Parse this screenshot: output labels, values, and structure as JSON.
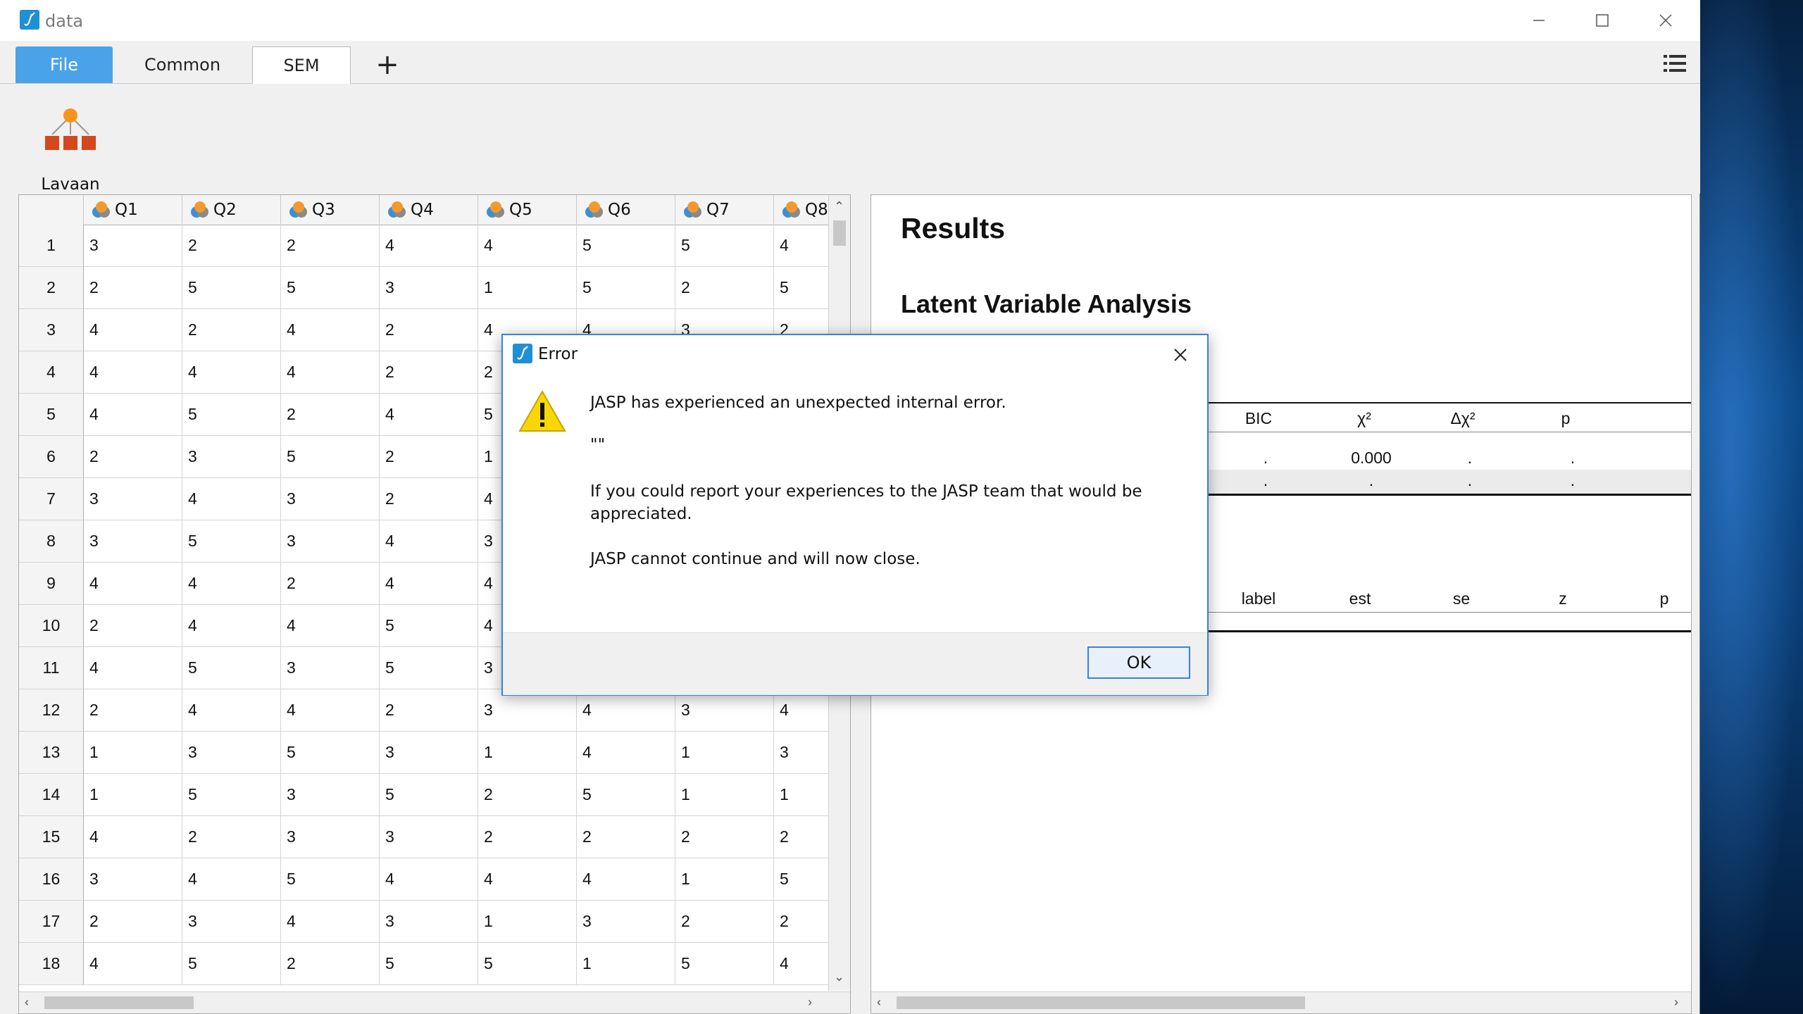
{
  "window": {
    "title": "data"
  },
  "tabs": [
    {
      "label": "File"
    },
    {
      "label": "Common"
    },
    {
      "label": "SEM"
    },
    {
      "label": "+"
    }
  ],
  "ribbon": {
    "lavaan_label": "Lavaan"
  },
  "grid": {
    "columns": [
      "Q1",
      "Q2",
      "Q3",
      "Q4",
      "Q5",
      "Q6",
      "Q7",
      "Q8"
    ],
    "rows": [
      {
        "n": "1",
        "v": [
          "3",
          "2",
          "2",
          "4",
          "4",
          "5",
          "5",
          "4"
        ]
      },
      {
        "n": "2",
        "v": [
          "2",
          "5",
          "5",
          "3",
          "1",
          "5",
          "2",
          "5"
        ]
      },
      {
        "n": "3",
        "v": [
          "4",
          "2",
          "4",
          "2",
          "4",
          "4",
          "3",
          "2"
        ]
      },
      {
        "n": "4",
        "v": [
          "4",
          "4",
          "4",
          "2",
          "2",
          "",
          "",
          ""
        ]
      },
      {
        "n": "5",
        "v": [
          "4",
          "5",
          "2",
          "4",
          "5",
          "",
          "",
          ""
        ]
      },
      {
        "n": "6",
        "v": [
          "2",
          "3",
          "5",
          "2",
          "1",
          "",
          "",
          ""
        ]
      },
      {
        "n": "7",
        "v": [
          "3",
          "4",
          "3",
          "2",
          "4",
          "",
          "",
          ""
        ]
      },
      {
        "n": "8",
        "v": [
          "3",
          "5",
          "3",
          "4",
          "3",
          "",
          "",
          ""
        ]
      },
      {
        "n": "9",
        "v": [
          "4",
          "4",
          "2",
          "4",
          "4",
          "",
          "",
          ""
        ]
      },
      {
        "n": "10",
        "v": [
          "2",
          "4",
          "4",
          "5",
          "4",
          "",
          "",
          ""
        ]
      },
      {
        "n": "11",
        "v": [
          "4",
          "5",
          "3",
          "5",
          "3",
          "",
          "",
          ""
        ]
      },
      {
        "n": "12",
        "v": [
          "2",
          "4",
          "4",
          "2",
          "3",
          "4",
          "3",
          "4"
        ]
      },
      {
        "n": "13",
        "v": [
          "1",
          "3",
          "5",
          "3",
          "1",
          "4",
          "1",
          "3"
        ]
      },
      {
        "n": "14",
        "v": [
          "1",
          "5",
          "3",
          "5",
          "2",
          "5",
          "1",
          "1"
        ]
      },
      {
        "n": "15",
        "v": [
          "4",
          "2",
          "3",
          "3",
          "2",
          "2",
          "2",
          "2"
        ]
      },
      {
        "n": "16",
        "v": [
          "3",
          "4",
          "5",
          "4",
          "4",
          "4",
          "1",
          "5"
        ]
      },
      {
        "n": "17",
        "v": [
          "2",
          "3",
          "4",
          "3",
          "1",
          "3",
          "2",
          "2"
        ]
      },
      {
        "n": "18",
        "v": [
          "4",
          "5",
          "2",
          "5",
          "5",
          "1",
          "5",
          "4"
        ]
      }
    ]
  },
  "results": {
    "title": "Results",
    "subtitle": "Latent Variable Analysis",
    "fit_table": {
      "headers": [
        "BIC",
        "χ²",
        "Δχ²",
        "p"
      ],
      "row1": [
        ".",
        "0.000",
        ".",
        "."
      ],
      "row2": [
        ".",
        ".",
        ".",
        "."
      ]
    },
    "param_table": {
      "headers": [
        "label",
        "est",
        "se",
        "z",
        "p"
      ]
    }
  },
  "dialog": {
    "title": "Error",
    "line1": "JASP has experienced an unexpected internal error.",
    "line2": "\"\"",
    "line3": "If you could report your experiences to the JASP team that would be",
    "line4": "appreciated.",
    "line5": "JASP cannot continue and will now close.",
    "ok_label": "OK"
  }
}
